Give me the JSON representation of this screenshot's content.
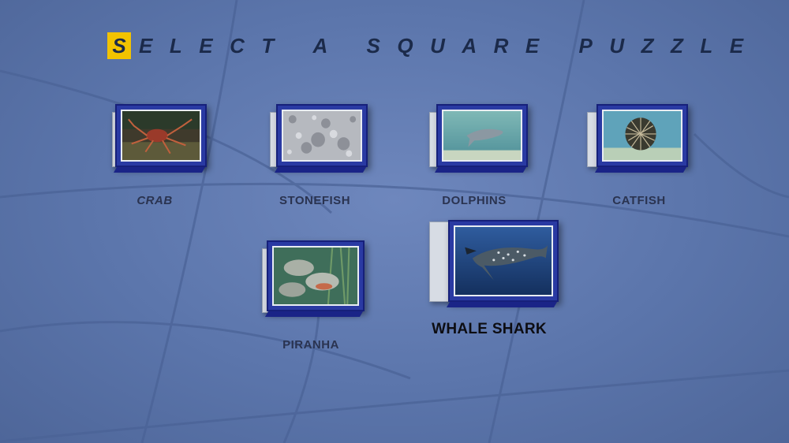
{
  "title": {
    "first_letter": "S",
    "rest": "ELECT A SQUARE PUZZLE"
  },
  "puzzles": [
    {
      "label": "CRAB",
      "image": "crab-photo",
      "selected": false
    },
    {
      "label": "STONEFISH",
      "image": "stonefish-photo",
      "selected": false
    },
    {
      "label": "DOLPHINS",
      "image": "dolphins-photo",
      "selected": false
    },
    {
      "label": "CATFISH",
      "image": "catfish-photo",
      "selected": false
    },
    {
      "label": "PIRANHA",
      "image": "piranha-photo",
      "selected": false
    },
    {
      "label": "WHALE SHARK",
      "image": "whale-shark-photo",
      "selected": true
    }
  ],
  "colors": {
    "background": "#5b75ab",
    "box_blue": "#2a3aa3",
    "title_highlight": "#f2c300",
    "label_text": "#2a3350"
  }
}
